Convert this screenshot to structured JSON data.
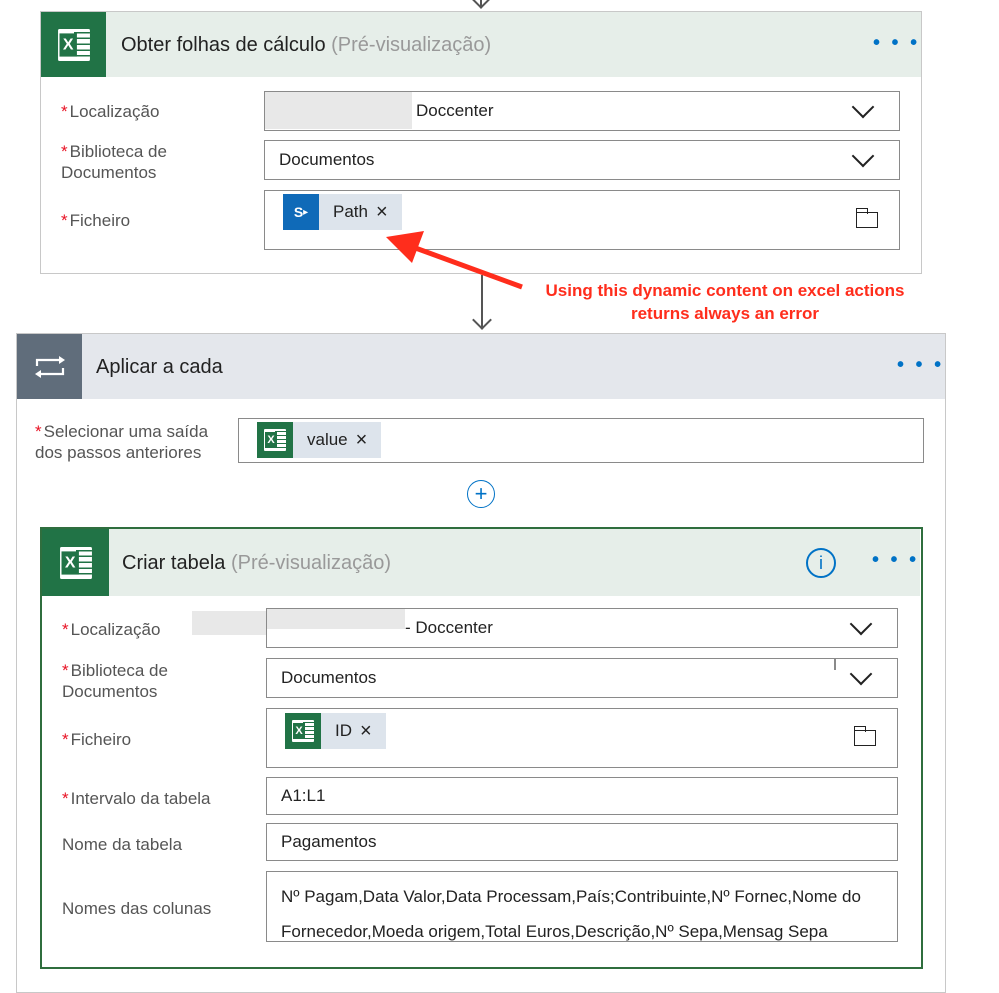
{
  "card1": {
    "title": "Obter folhas de cálculo",
    "preview": "(Pré-visualização)",
    "menu": "• • •",
    "fields": {
      "location_label": "Localização",
      "location_value": "Doccenter",
      "library_label_1": "Biblioteca de",
      "library_label_2": "Documentos",
      "library_value": "Documentos",
      "file_label": "Ficheiro",
      "file_token": "Path"
    }
  },
  "annotation": {
    "line1": "Using this dynamic content on excel actions",
    "line2": "returns always an error",
    "color": "#ff2d1c"
  },
  "loop": {
    "title": "Aplicar a cada",
    "menu": "• • •",
    "select_label_1": "Selecionar uma saída",
    "select_label_2": "dos passos anteriores",
    "select_token": "value"
  },
  "card2": {
    "title": "Criar tabela",
    "preview": "(Pré-visualização)",
    "menu": "• • •",
    "fields": {
      "location_label": "Localização",
      "location_value": "- Doccenter",
      "library_label_1": "Biblioteca de",
      "library_label_2": "Documentos",
      "library_value": "Documentos",
      "file_label": "Ficheiro",
      "file_token": "ID",
      "range_label": "Intervalo da tabela",
      "range_value": "A1:L1",
      "name_label": "Nome da tabela",
      "name_value": "Pagamentos",
      "columns_label": "Nomes das colunas",
      "columns_line1": "Nº Pagam,Data Valor,Data Processam,País;Contribuinte,Nº Fornec,Nome do",
      "columns_line2": "Fornecedor,Moeda origem,Total Euros,Descrição,Nº Sepa,Mensag Sepa"
    }
  },
  "colors": {
    "excel_green": "#217346",
    "header_bg": "#e6eee9",
    "loop_header_bg": "#e4e7ec",
    "loop_icon_bg": "#606d7b",
    "accent_blue": "#0072c6"
  }
}
